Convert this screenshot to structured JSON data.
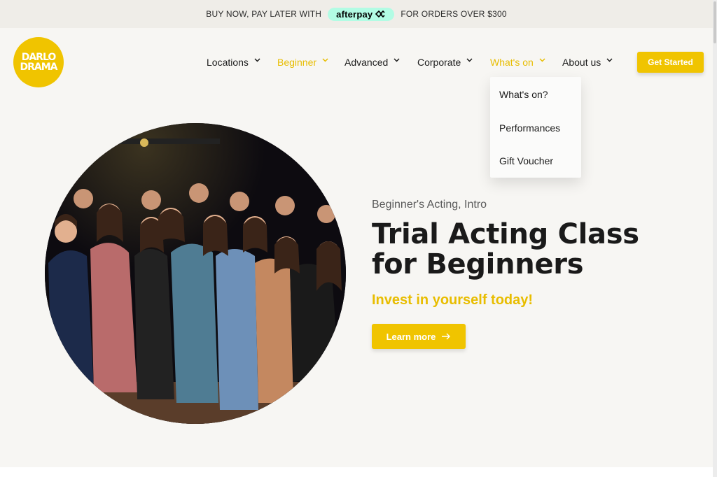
{
  "promo": {
    "left_text": "BUY NOW, PAY LATER WITH",
    "badge_text": "afterpay",
    "right_text": "FOR ORDERS OVER $300"
  },
  "logo": {
    "line1": "DARLO",
    "line2": "DRAMA"
  },
  "nav": {
    "items": [
      {
        "label": "Locations"
      },
      {
        "label": "Beginner"
      },
      {
        "label": "Advanced"
      },
      {
        "label": "Corporate"
      },
      {
        "label": "What's on"
      },
      {
        "label": "About us"
      }
    ],
    "cta_label": "Get Started"
  },
  "dropdown": {
    "items": [
      {
        "label": "What's on?"
      },
      {
        "label": "Performances"
      },
      {
        "label": "Gift Voucher"
      }
    ]
  },
  "hero": {
    "subtitle": "Beginner's Acting, Intro",
    "title": "Trial Acting Class for Beginners",
    "tagline": "Invest in yourself today!",
    "button_label": "Learn more"
  },
  "colors": {
    "brand_yellow": "#f0c400",
    "afterpay_mint": "#b2fce4",
    "background": "#f7f6f3"
  }
}
